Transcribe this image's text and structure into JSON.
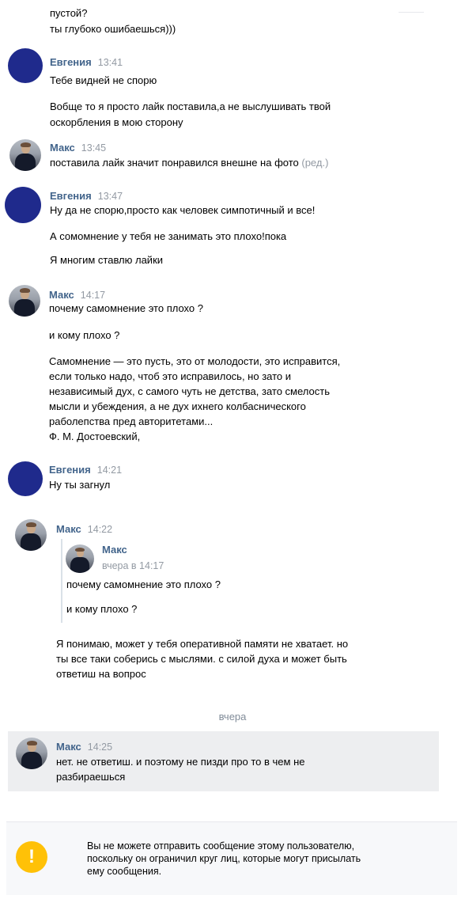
{
  "messages": [
    {
      "lines": [
        "пустой?",
        "ты глубоко ошибаешься)))"
      ]
    },
    {
      "sender": "Евгения",
      "time": "13:41",
      "lines": [
        "Тебе видней не спорю",
        "Вобще то я просто лайк поставила,а не выслушивать твой",
        "оскорбления в мою сторону"
      ]
    },
    {
      "sender": "Макс",
      "time": "13:45",
      "lines": [
        "поставила лайк значит понравился внешне на фото"
      ],
      "edited_label": "(ред.)"
    },
    {
      "sender": "Евгения",
      "time": "13:47",
      "lines": [
        "Ну да не спорю,просто как человек симпотичный и все!",
        "А сомомнение у тебя не занимать это плохо!пока",
        "Я многим ставлю лайки"
      ]
    },
    {
      "sender": "Макс",
      "time": "14:17",
      "lines": [
        "почему самомнение это плохо ?",
        "и кому плохо ?",
        "Самомнение — это пусть, это от молодости, это исправится,",
        "если только надо, чтоб это исправилось, но зато и",
        "независимый дух, с самого чуть не детства, зато смелость",
        "мысли и убеждения, а не дух ихнего колбаснического",
        "раболепства пред авторитетами...",
        "Ф. М. Достоевский,"
      ]
    },
    {
      "sender": "Евгения",
      "time": "14:21",
      "lines": [
        "Ну ты загнул"
      ]
    },
    {
      "sender": "Макс",
      "time": "14:22",
      "forwarded": {
        "sender": "Макс",
        "time": "вчера в 14:17",
        "lines": [
          "почему самомнение это плохо ?",
          "и кому плохо ?"
        ]
      },
      "lines": [
        "Я понимаю, может у тебя оперативной памяти не хватает. но",
        "ты все таки соберись с мыслями. с силой духа и может быть",
        "ответиш на вопрос"
      ]
    },
    {
      "sender": "Макс",
      "time": "14:25",
      "lines": [
        "нет. не ответиш. и поэтому не пизди про то в чем не",
        "разбираешься"
      ]
    }
  ],
  "day_separator": "вчера",
  "notice": {
    "icon": "warning-icon",
    "glyph": "!",
    "lines": [
      "Вы не можете отправить сообщение этому пользователю,",
      "поскольку он ограничил круг лиц, которые могут присылать",
      "ему сообщения."
    ]
  },
  "colors": {
    "name": "#42648b",
    "time": "#939aa3",
    "avatar_evgenia": "#1f2a8c",
    "warning": "#ffc107",
    "highlight": "#edeef0"
  }
}
